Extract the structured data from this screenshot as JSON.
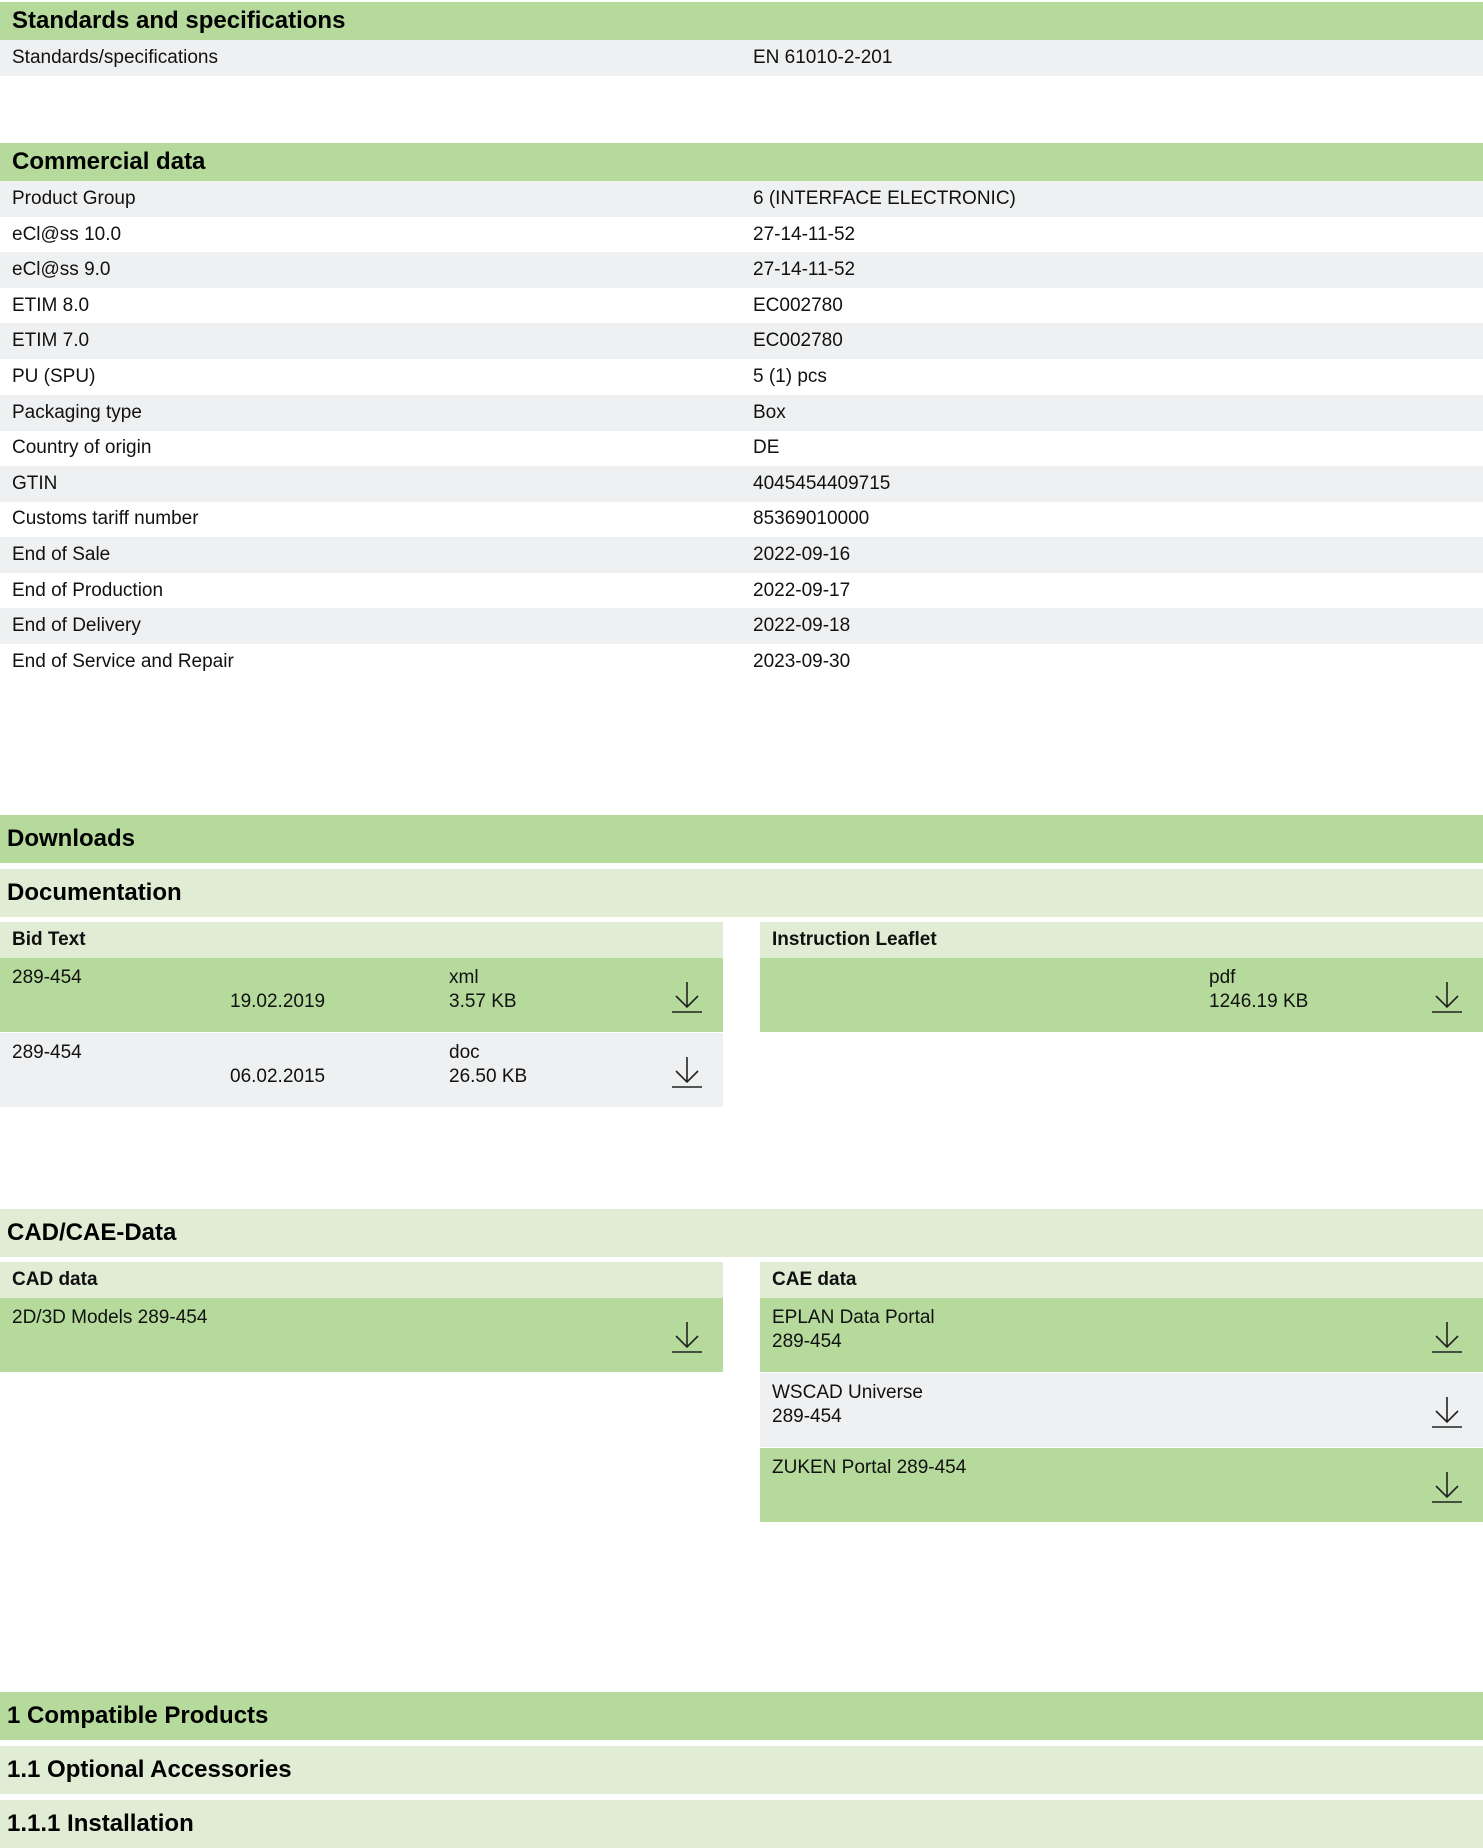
{
  "standards": {
    "title": "Standards and specifications",
    "rows": [
      {
        "label": "Standards/specifications",
        "value": "EN 61010-2-201"
      }
    ]
  },
  "commercial": {
    "title": "Commercial data",
    "rows": [
      {
        "label": "Product Group",
        "value": "6 (INTERFACE ELECTRONIC)"
      },
      {
        "label": "eCl@ss 10.0",
        "value": "27-14-11-52"
      },
      {
        "label": "eCl@ss 9.0",
        "value": "27-14-11-52"
      },
      {
        "label": "ETIM 8.0",
        "value": "EC002780"
      },
      {
        "label": "ETIM 7.0",
        "value": "EC002780"
      },
      {
        "label": "PU (SPU)",
        "value": "5 (1) pcs"
      },
      {
        "label": "Packaging type",
        "value": "Box"
      },
      {
        "label": "Country of origin",
        "value": "DE"
      },
      {
        "label": "GTIN",
        "value": "4045454409715"
      },
      {
        "label": "Customs tariff number",
        "value": "85369010000"
      },
      {
        "label": "End of Sale",
        "value": "2022-09-16"
      },
      {
        "label": "End of Production",
        "value": "2022-09-17"
      },
      {
        "label": "End of Delivery",
        "value": "2022-09-18"
      },
      {
        "label": "End of Service and Repair",
        "value": "2023-09-30"
      }
    ]
  },
  "downloads": {
    "title": "Downloads",
    "documentation": {
      "title": "Documentation",
      "bid_text": {
        "title": "Bid Text",
        "items": [
          {
            "name": "289-454",
            "date": "19.02.2019",
            "format": "xml",
            "size": "3.57 KB"
          },
          {
            "name": "289-454",
            "date": "06.02.2015",
            "format": "doc",
            "size": "26.50 KB"
          }
        ]
      },
      "instruction_leaflet": {
        "title": "Instruction Leaflet",
        "items": [
          {
            "format": "pdf",
            "size": "1246.19 KB"
          }
        ]
      }
    },
    "cad_cae": {
      "title": "CAD/CAE-Data",
      "cad": {
        "title": "CAD data",
        "items": [
          {
            "line1": "2D/3D Models 289-454"
          }
        ]
      },
      "cae": {
        "title": "CAE data",
        "items": [
          {
            "line1": "EPLAN Data Portal",
            "line2": "289-454"
          },
          {
            "line1": "WSCAD Universe",
            "line2": "289-454"
          },
          {
            "line1": "ZUKEN Portal 289-454"
          }
        ]
      }
    }
  },
  "compatible": {
    "title": "1 Compatible Products",
    "optional": "1.1 Optional Accessories",
    "installation": "1.1.1 Installation"
  },
  "icons": {
    "download": "download-icon"
  },
  "colors": {
    "section_green": "#b5da9c",
    "light_green": "#e0edd4",
    "row_grey": "#eff0f1"
  }
}
